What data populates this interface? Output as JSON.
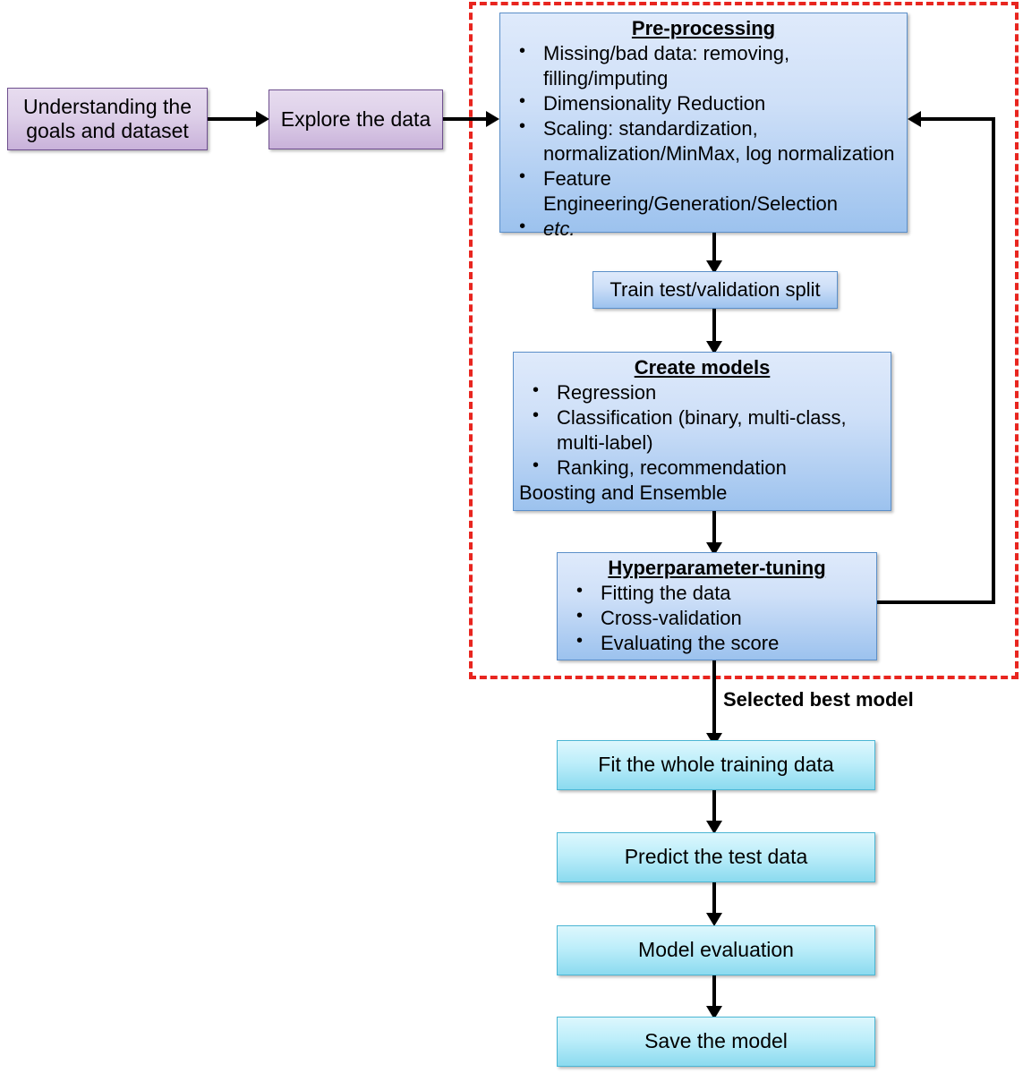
{
  "diagram": {
    "title": "Machine Learning Workflow Flowchart",
    "colors": {
      "purple_fill_top": "#e7dcef",
      "purple_fill_bottom": "#c9b2da",
      "purple_border": "#6e4f8e",
      "blue_fill_top": "#dfeafb",
      "blue_fill_bottom": "#9cc2ee",
      "blue_border": "#5b8fc9",
      "cyan_fill_top": "#ddf7fd",
      "cyan_fill_bottom": "#8bdaef",
      "cyan_border": "#4bb6d4",
      "dashed_region_border": "#e8251f",
      "connector": "#000000"
    }
  },
  "nodes": {
    "understanding": {
      "label": "Understanding the goals and dataset"
    },
    "explore": {
      "label": "Explore the data"
    },
    "preprocessing": {
      "title": "Pre-processing",
      "items": [
        "Missing/bad data: removing, filling/imputing",
        "Dimensionality Reduction",
        "Scaling: standardization, normalization/MinMax, log normalization",
        "Feature Engineering/Generation/Selection",
        "etc."
      ]
    },
    "split": {
      "label": "Train test/validation split"
    },
    "create_models": {
      "title": "Create models",
      "items": [
        "Regression",
        "Classification (binary, multi-class, multi-label)",
        "Ranking, recommendation"
      ],
      "trailing_text": "Boosting and Ensemble"
    },
    "hyperparameter": {
      "title": "Hyperparameter-tuning",
      "items": [
        "Fitting the data",
        "Cross-validation",
        "Evaluating the score"
      ]
    },
    "fit_whole": {
      "label": "Fit the whole training data"
    },
    "predict_test": {
      "label": "Predict the test data"
    },
    "model_evaluation": {
      "label": "Model evaluation"
    },
    "save_model": {
      "label": "Save the model"
    }
  },
  "annotations": {
    "selected_best_model": "Selected best model"
  }
}
